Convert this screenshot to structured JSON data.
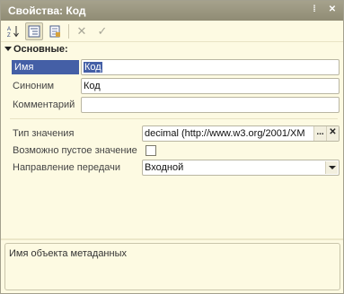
{
  "window": {
    "title": "Свойства: Код",
    "pin_glyph": "⁞",
    "close_glyph": "✕"
  },
  "toolbar": {
    "buttons": [
      {
        "icon": "sort-alphabetical-icon",
        "active": false
      },
      {
        "icon": "categorized-view-icon",
        "active": true
      },
      {
        "icon": "properties-page-icon",
        "active": false
      },
      {
        "icon": "clear-value-icon",
        "active": false
      },
      {
        "icon": "apply-check-icon",
        "active": false
      }
    ],
    "clear_glyph": "✕",
    "apply_glyph": "✓"
  },
  "section": {
    "title": "Основные:"
  },
  "properties": {
    "name": {
      "label": "Имя",
      "value": "Код"
    },
    "synonym": {
      "label": "Синоним",
      "value": "Код"
    },
    "comment": {
      "label": "Комментарий",
      "value": ""
    },
    "value_type": {
      "label": "Тип значения",
      "value": "decimal (http://www.w3.org/2001/XM",
      "select_glyph": "...",
      "clear_glyph": "✕"
    },
    "nillable": {
      "label": "Возможно пустое значение",
      "checked": false
    },
    "direction": {
      "label": "Направление передачи",
      "value": "Входной"
    }
  },
  "description": {
    "text": "Имя объекта метаданных"
  }
}
